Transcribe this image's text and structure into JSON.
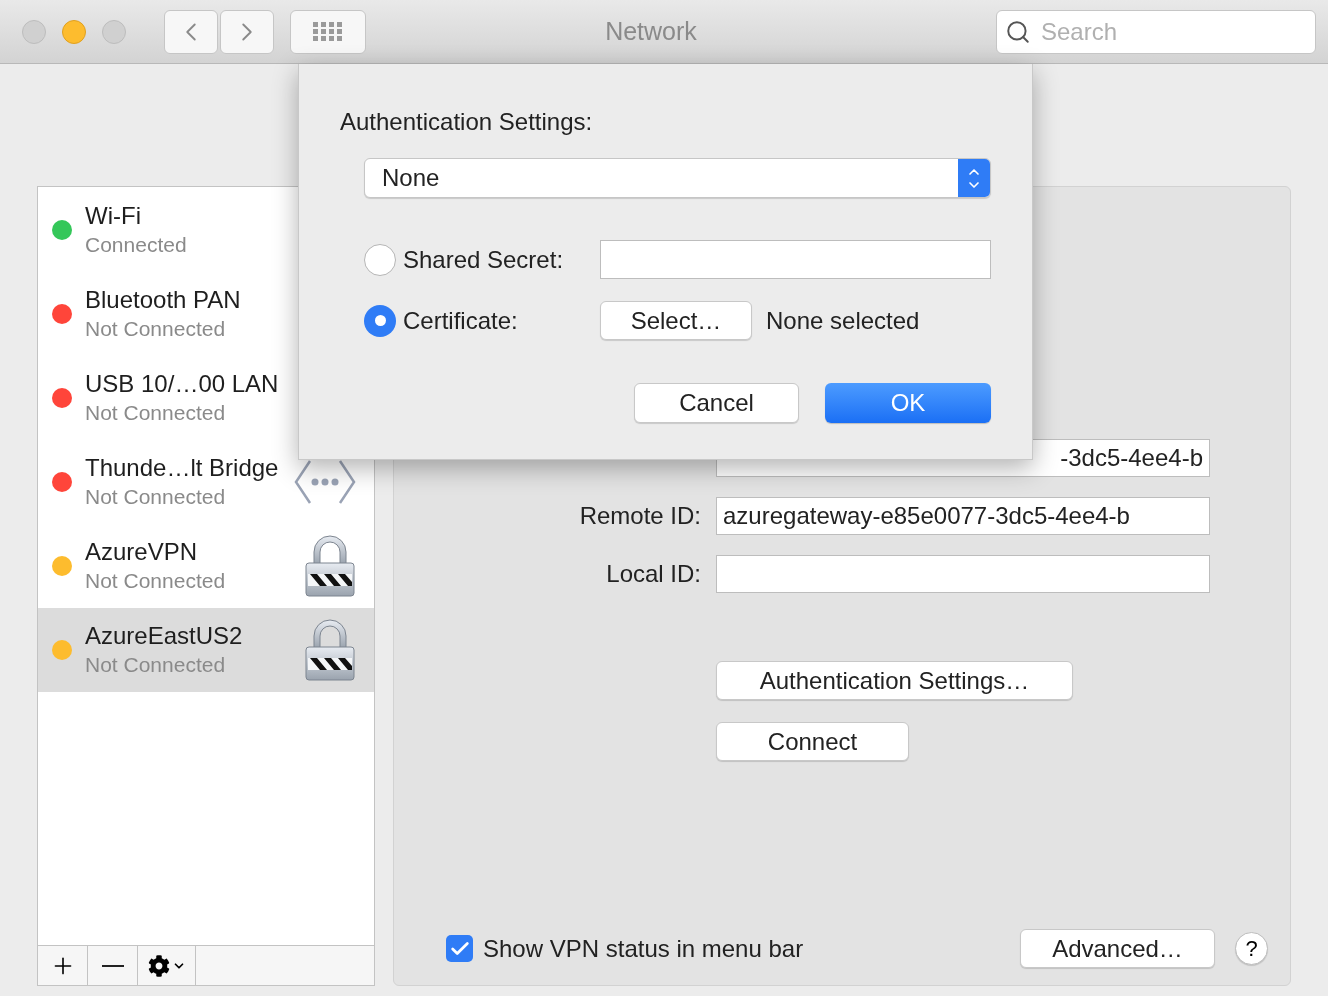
{
  "window": {
    "title": "Network",
    "search": {
      "placeholder": "Search"
    }
  },
  "sidebar": {
    "items": [
      {
        "name": "Wi-Fi",
        "status": "Connected",
        "color": "#34c759",
        "selected": false,
        "kind": "plain"
      },
      {
        "name": "Bluetooth PAN",
        "status": "Not Connected",
        "color": "#ff453a",
        "selected": false,
        "kind": "plain"
      },
      {
        "name": "USB 10/…00 LAN",
        "status": "Not Connected",
        "color": "#ff453a",
        "selected": false,
        "kind": "plain"
      },
      {
        "name": "Thunde…lt Bridge",
        "status": "Not Connected",
        "color": "#ff453a",
        "selected": false,
        "kind": "bridge"
      },
      {
        "name": "AzureVPN",
        "status": "Not Connected",
        "color": "#fdbc2e",
        "selected": false,
        "kind": "vpn"
      },
      {
        "name": "AzureEastUS2",
        "status": "Not Connected",
        "color": "#fdbc2e",
        "selected": true,
        "kind": "vpn"
      }
    ]
  },
  "panel": {
    "fields": [
      {
        "value": "-3dc5-4ee4-b"
      },
      {
        "label": "Remote ID:",
        "value": "azuregateway-e85e0077-3dc5-4ee4-b"
      },
      {
        "label": "Local ID:"
      }
    ],
    "auth_button": "Authentication Settings…",
    "connect_button": "Connect",
    "show_status": {
      "label": "Show VPN status in menu bar",
      "checked": true
    },
    "advanced_button": "Advanced…",
    "help": "?"
  },
  "sheet": {
    "title": "Authentication Settings:",
    "popup": "None",
    "options": [
      {
        "kind": "field",
        "label": "Shared Secret:",
        "selected": false
      },
      {
        "kind": "certificate",
        "label": "Certificate:",
        "selected": true,
        "button": "Select…",
        "note": "None selected"
      }
    ],
    "cancel": "Cancel",
    "ok": "OK"
  }
}
